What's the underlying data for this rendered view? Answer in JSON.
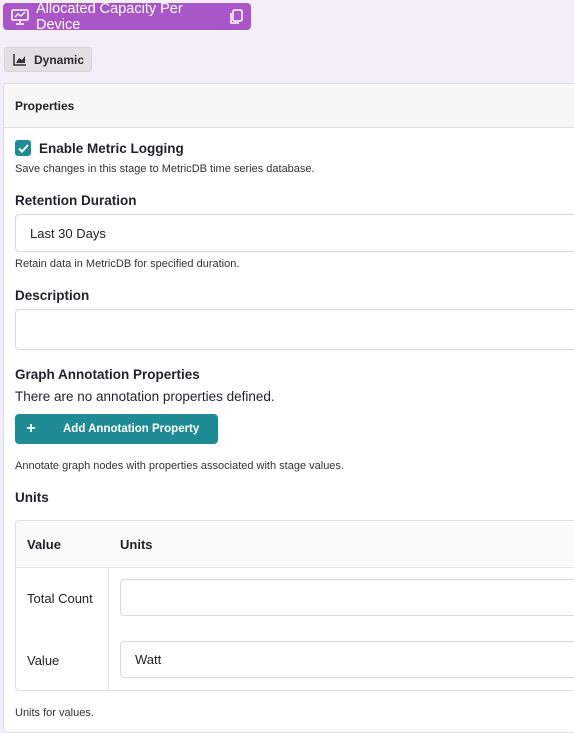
{
  "header": {
    "title": "Allocated Capacity Per Device",
    "title_icon": "monitor-chart-icon",
    "copy_icon": "copy-icon",
    "accent": "#a956c9"
  },
  "mode_button": {
    "label": "Dynamic",
    "icon": "chart-area-icon"
  },
  "panel": {
    "heading": "Properties",
    "metric_logging": {
      "label": "Enable Metric Logging",
      "checked": true,
      "help": "Save changes in this stage to MetricDB time series database."
    },
    "retention": {
      "label": "Retention Duration",
      "value": "Last 30 Days",
      "help": "Retain data in MetricDB for specified duration."
    },
    "description": {
      "label": "Description",
      "value": ""
    },
    "graph_annotation": {
      "label": "Graph Annotation Properties",
      "empty_text": "There are no annotation properties defined.",
      "add_label": "Add Annotation Property",
      "add_icon": "plus-icon",
      "help": "Annotate graph nodes with properties associated with stage values."
    },
    "units": {
      "label": "Units",
      "columns": [
        "Value",
        "Units"
      ],
      "rows": [
        {
          "value": "Total Count",
          "units": ""
        },
        {
          "value": "Value",
          "units": "Watt"
        }
      ],
      "help": "Units for values."
    },
    "teal": "#1f8b94"
  }
}
